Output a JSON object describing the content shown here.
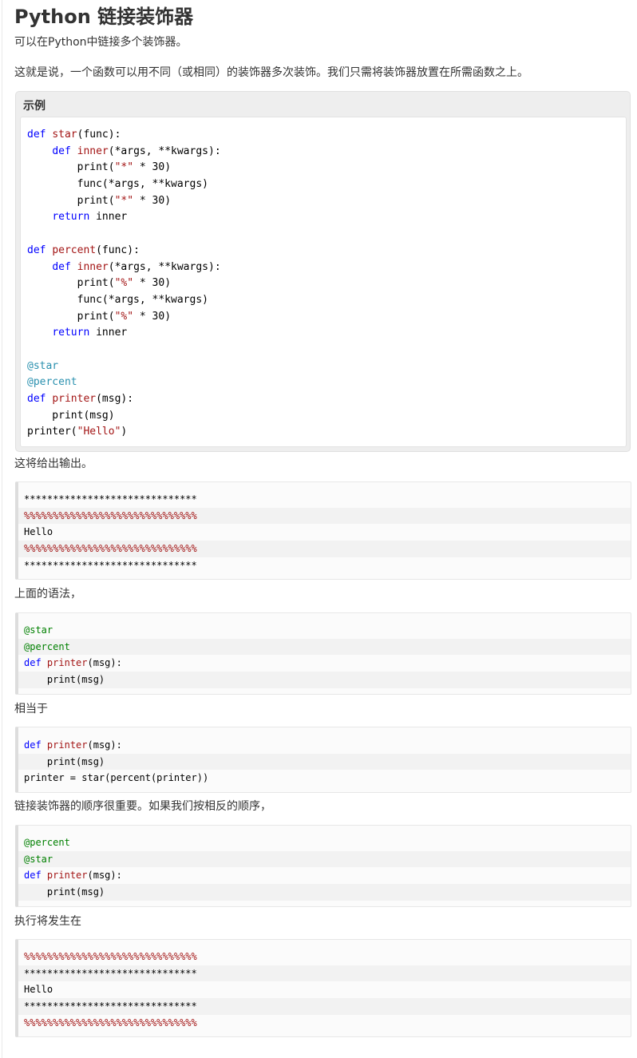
{
  "title": "Python 链接装饰器",
  "intro1": "可以在Python中链接多个装饰器。",
  "intro2": "这就是说，一个函数可以用不同（或相同）的装饰器多次装饰。我们只需将装饰器放置在所需函数之上。",
  "example": {
    "heading": "示例",
    "lines": [
      "def star(func):",
      "    def inner(*args, **kwargs):",
      "        print(\"*\" * 30)",
      "        func(*args, **kwargs)",
      "        print(\"*\" * 30)",
      "    return inner",
      "",
      "def percent(func):",
      "    def inner(*args, **kwargs):",
      "        print(\"%\" * 30)",
      "        func(*args, **kwargs)",
      "        print(\"%\" * 30)",
      "    return inner",
      "",
      "@star",
      "@percent",
      "def printer(msg):",
      "    print(msg)",
      "printer(\"Hello\")"
    ]
  },
  "text_output_intro": "这将给出输出。",
  "output1": [
    "******************************",
    "%%%%%%%%%%%%%%%%%%%%%%%%%%%%%%",
    "Hello",
    "%%%%%%%%%%%%%%%%%%%%%%%%%%%%%%",
    "******************************"
  ],
  "text_syntax": "上面的语法，",
  "block_syntax": [
    "@star",
    "@percent",
    "def printer(msg):",
    "    print(msg)"
  ],
  "text_equiv": "相当于",
  "block_equiv": [
    "def printer(msg):",
    "    print(msg)",
    "printer = star(percent(printer))"
  ],
  "text_order": "链接装饰器的顺序很重要。如果我们按相反的顺序，",
  "block_reverse": [
    "@percent",
    "@star",
    "def printer(msg):",
    "    print(msg)"
  ],
  "text_exec": "执行将发生在",
  "output2": [
    "%%%%%%%%%%%%%%%%%%%%%%%%%%%%%%",
    "******************************",
    "Hello",
    "******************************",
    "%%%%%%%%%%%%%%%%%%%%%%%%%%%%%%"
  ]
}
